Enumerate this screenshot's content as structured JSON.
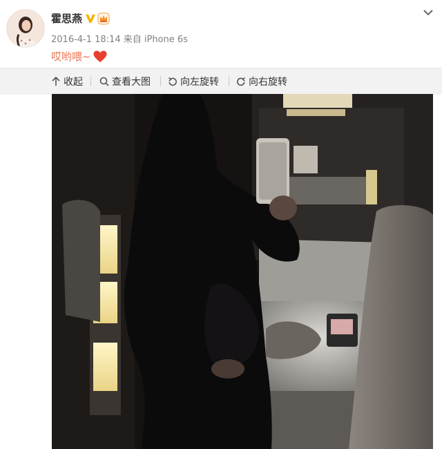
{
  "post": {
    "username": "霍思燕",
    "meta": "2016-4-1 18:14 来自 iPhone 6s",
    "caption_text": "哎哟喂~",
    "icons": {
      "verified": "verified-v-icon",
      "vip": "crown-icon",
      "caption_heart": "heart-icon",
      "menu": "chevron-down-icon"
    }
  },
  "toolbar": {
    "collapse_label": "收起",
    "view_large_label": "查看大图",
    "rotate_left_label": "向左旋转",
    "rotate_right_label": "向右旋转"
  },
  "colors": {
    "caption": "#eb7350",
    "heart": "#e8402f",
    "verified": "#f5b400",
    "toolbar_bg": "#f2f2f2"
  }
}
